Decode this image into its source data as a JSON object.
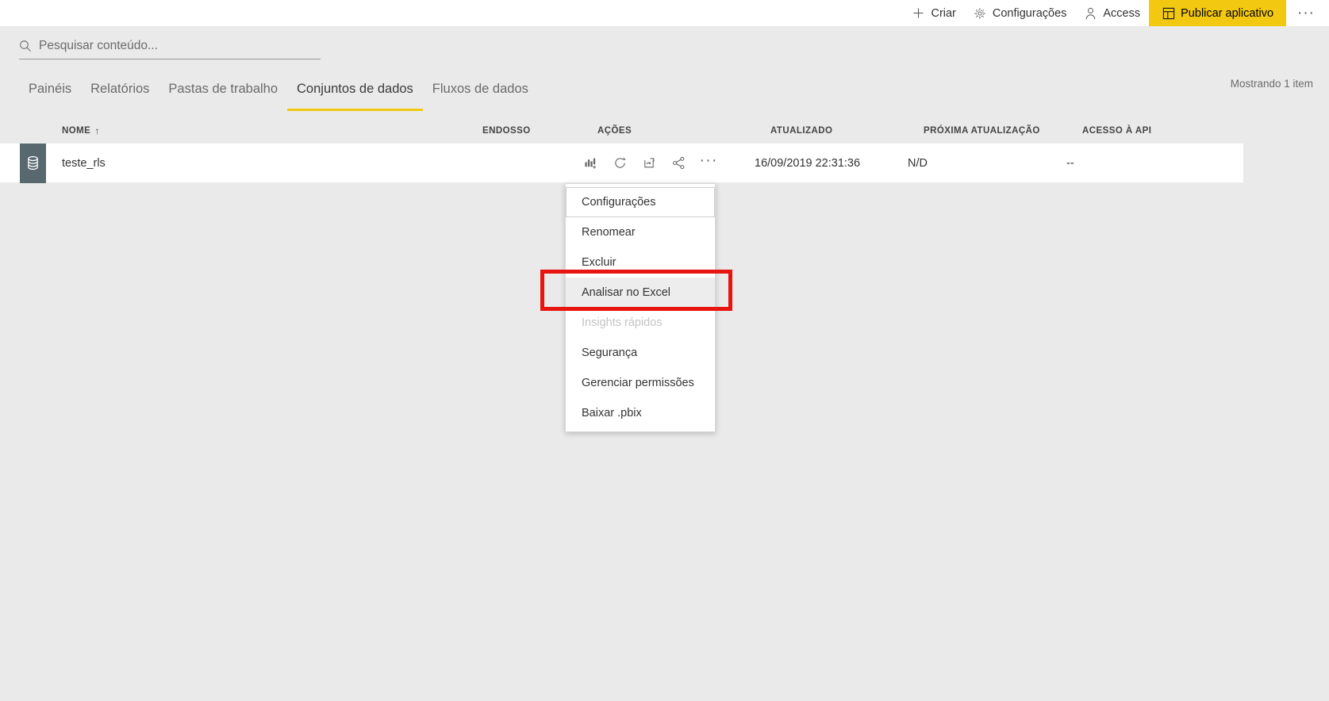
{
  "topbar": {
    "items": [
      {
        "label": "Criar",
        "icon": "plus-icon"
      },
      {
        "label": "Configurações",
        "icon": "gear-icon"
      },
      {
        "label": "Access",
        "icon": "person-icon"
      },
      {
        "label": "Publicar aplicativo",
        "icon": "app-publish-icon"
      }
    ],
    "overflow_label": "···",
    "publish_bg": "#f2c811"
  },
  "search": {
    "placeholder": "Pesquisar conteúdo...",
    "value": "",
    "icon": "search-icon"
  },
  "tabs": [
    {
      "label": "Painéis",
      "active": false
    },
    {
      "label": "Relatórios",
      "active": false
    },
    {
      "label": "Pastas de trabalho",
      "active": false
    },
    {
      "label": "Conjuntos de dados",
      "active": true
    },
    {
      "label": "Fluxos de dados",
      "active": false
    }
  ],
  "showing_text": "Mostrando 1 item",
  "table": {
    "headers": {
      "name": "NOME",
      "sort_arrow": "↑",
      "endorsement": "ENDOSSO",
      "actions": "AÇÕES",
      "updated": "ATUALIZADO",
      "next_refresh": "PRÓXIMA ATUALIZAÇÃO",
      "api_access": "ACESSO À API"
    },
    "rows": [
      {
        "icon": "dataset-icon",
        "name": "teste_rls",
        "endorsement": "",
        "actions": [
          "create-report-icon",
          "refresh-now-icon",
          "schedule-refresh-icon",
          "share-icon",
          "more-options-icon"
        ],
        "updated": "16/09/2019 22:31:36",
        "next_refresh": "N/D",
        "api_access": "--"
      }
    ]
  },
  "context_menu": {
    "items": [
      {
        "label": "Configurações",
        "state": "focused"
      },
      {
        "label": "Renomear",
        "state": "normal"
      },
      {
        "label": "Excluir",
        "state": "normal"
      },
      {
        "label": "Analisar no Excel",
        "state": "highlighted"
      },
      {
        "label": "Insights rápidos",
        "state": "disabled"
      },
      {
        "label": "Segurança",
        "state": "normal"
      },
      {
        "label": "Gerenciar permissões",
        "state": "normal"
      },
      {
        "label": "Baixar .pbix",
        "state": "normal"
      }
    ]
  },
  "annotation": {
    "color": "#e8140f",
    "target": "Analisar no Excel"
  }
}
